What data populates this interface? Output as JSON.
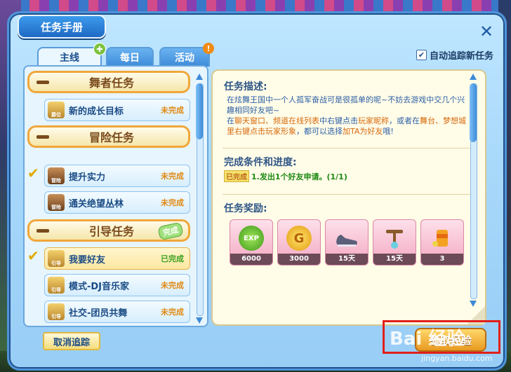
{
  "window": {
    "title": "任务手册",
    "close_glyph": "✕"
  },
  "tabs": [
    {
      "label": "主线",
      "active": true
    },
    {
      "label": "每日",
      "active": false
    },
    {
      "label": "活动",
      "active": false
    }
  ],
  "auto_track": {
    "label": "自动追踪新任务",
    "checked": true
  },
  "sections": [
    {
      "title": "舞者任务"
    },
    {
      "title": "冒险任务"
    },
    {
      "title": "引导任务",
      "badge": "完成"
    }
  ],
  "items": [
    {
      "label": "新的成长目标",
      "status": "未完成",
      "icon_text": "爵位"
    },
    {
      "label": "提升实力",
      "status": "未完成",
      "icon_text": "冒险"
    },
    {
      "label": "通关绝望丛林",
      "status": "未完成",
      "icon_text": "冒险"
    },
    {
      "label": "我要好友",
      "status": "已完成",
      "icon_text": "引导"
    },
    {
      "label": "模式-DJ音乐家",
      "status": "未完成",
      "icon_text": "引导"
    },
    {
      "label": "社交-团员共舞",
      "status": "未完成",
      "icon_text": "引导"
    }
  ],
  "detail": {
    "desc_label": "任务描述:",
    "desc_line1": "在炫舞王国中一个人孤军奋战可是很孤单的呢~不妨去游戏中交几个兴趣相同好友吧~",
    "desc_line2a": "在",
    "desc_line2_hl1": "聊天窗口、频道在线列表",
    "desc_line2b": "中右键点击",
    "desc_line2_hl2": "玩家昵称",
    "desc_line2c": "，或者在",
    "desc_line2_hl3": "舞台、梦想城里右键点击玩家形象",
    "desc_line2d": "，都可以选择",
    "desc_line2_hl4": "加TA为好友",
    "desc_line2e": "哦!",
    "cond_label": "完成条件和进度:",
    "cond_tag": "已完成",
    "cond_text": "1.发出1个好友申请。(1/1)",
    "reward_label": "任务奖励:",
    "rewards": [
      {
        "icon": "exp-icon",
        "qty": "6000",
        "icon_text": "EXP"
      },
      {
        "icon": "gold-coin-icon",
        "qty": "3000",
        "icon_text": "G"
      },
      {
        "icon": "shoes-icon",
        "qty": "15天"
      },
      {
        "icon": "pendant-icon",
        "qty": "15天"
      },
      {
        "icon": "drink-icon",
        "qty": "3"
      }
    ]
  },
  "buttons": {
    "untrack": "取消追踪",
    "claim": "领取经验"
  },
  "watermark": {
    "text": "Bai 经验",
    "url": "jingyan.baidu.com"
  }
}
